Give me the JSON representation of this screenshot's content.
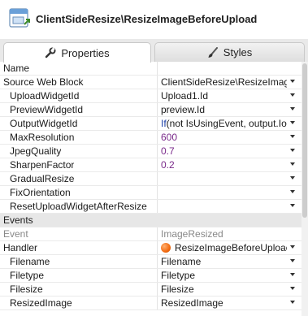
{
  "header": {
    "title": "ClientSideResize\\ResizeImageBeforeUpload",
    "icon": "web-block-icon"
  },
  "tabs": [
    {
      "label": "Properties",
      "icon": "wrench-icon",
      "active": true
    },
    {
      "label": "Styles",
      "icon": "brush-icon",
      "active": false
    }
  ],
  "rows": [
    {
      "name": "Name",
      "value": "",
      "indent": false,
      "dropdown": false,
      "value_style": ""
    },
    {
      "name": "Source Web Block",
      "value": "ClientSideResize\\ResizeImage",
      "indent": false,
      "dropdown": true,
      "value_style": ""
    },
    {
      "name": "UploadWidgetId",
      "value": "Upload1.Id",
      "indent": true,
      "dropdown": true,
      "value_style": ""
    },
    {
      "name": "PreviewWidgetId",
      "value": "preview.Id",
      "indent": true,
      "dropdown": true,
      "value_style": ""
    },
    {
      "name": "OutputWidgetId",
      "value": "If(not IsUsingEvent, output.Io",
      "indent": true,
      "dropdown": true,
      "value_style": "expr"
    },
    {
      "name": "MaxResolution",
      "value": "600",
      "indent": true,
      "dropdown": true,
      "value_style": "literal"
    },
    {
      "name": "JpegQuality",
      "value": "0.7",
      "indent": true,
      "dropdown": true,
      "value_style": "literal"
    },
    {
      "name": "SharpenFactor",
      "value": "0.2",
      "indent": true,
      "dropdown": true,
      "value_style": "literal"
    },
    {
      "name": "GradualResize",
      "value": "",
      "indent": true,
      "dropdown": true,
      "value_style": ""
    },
    {
      "name": "FixOrientation",
      "value": "",
      "indent": true,
      "dropdown": true,
      "value_style": ""
    },
    {
      "name": "ResetUploadWidgetAfterResize",
      "value": "",
      "indent": true,
      "dropdown": true,
      "value_style": ""
    },
    {
      "name": "Events",
      "value": "",
      "section": true
    },
    {
      "name": "Event",
      "value": "ImageResized",
      "indent": false,
      "dropdown": false,
      "value_style": "grey"
    },
    {
      "name": "Handler",
      "value": "ResizeImageBeforeUploac",
      "indent": false,
      "dropdown": true,
      "value_style": "handler"
    },
    {
      "name": "Filename",
      "value": "Filename",
      "indent": true,
      "dropdown": true,
      "value_style": ""
    },
    {
      "name": "Filetype",
      "value": "Filetype",
      "indent": true,
      "dropdown": true,
      "value_style": ""
    },
    {
      "name": "Filesize",
      "value": "Filesize",
      "indent": true,
      "dropdown": true,
      "value_style": ""
    },
    {
      "name": "ResizedImage",
      "value": "ResizedImage",
      "indent": true,
      "dropdown": true,
      "value_style": ""
    }
  ],
  "colors": {
    "literal": "#7a2a8a",
    "expr_keyword": "#1c3fa6",
    "handler_orb": "#f26a10"
  }
}
